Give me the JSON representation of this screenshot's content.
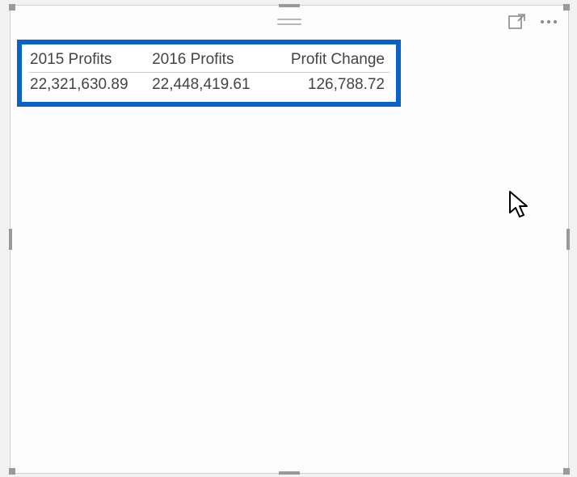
{
  "accent_color": "#0a62c9",
  "table": {
    "columns": [
      {
        "label": "2015 Profits",
        "align": "left"
      },
      {
        "label": "2016 Profits",
        "align": "left"
      },
      {
        "label": "Profit Change",
        "align": "right"
      }
    ],
    "rows": [
      {
        "c0": "22,321,630.89",
        "c1": "22,448,419.61",
        "c2": "126,788.72"
      }
    ]
  },
  "icons": {
    "focus_mode": "focus-mode-icon",
    "more": "more-options-icon",
    "drag": "drag-handle-icon"
  }
}
